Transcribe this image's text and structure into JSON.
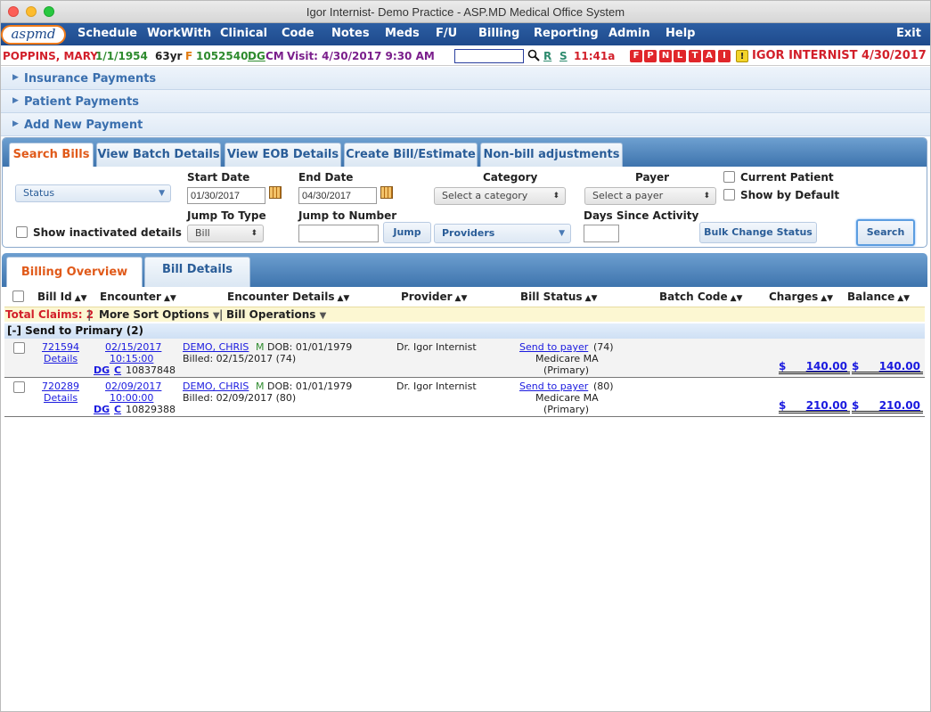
{
  "window": {
    "title": "Igor Internist- Demo Practice - ASP.MD Medical Office System"
  },
  "menubar": {
    "logo": "aspmd",
    "items": [
      "Schedule",
      "WorkWith",
      "Clinical",
      "Code",
      "Notes",
      "Meds",
      "F/U",
      "Billing",
      "Reporting",
      "Admin",
      "Help"
    ],
    "exit": "Exit"
  },
  "patient": {
    "name": "POPPINS, MARY",
    "dob": "1/1/1954",
    "age": "63yr",
    "sex": "F",
    "id": "1052540",
    "dg": "DG",
    "cm": "CM",
    "visit": "Visit: 4/30/2017 9:30 AM",
    "search_value": "",
    "r": "R",
    "s": "S",
    "time": "11:41a",
    "flags": [
      "F",
      "P",
      "N",
      "L",
      "T",
      "A",
      "I"
    ],
    "warning": "!",
    "doctor_date": "IGOR INTERNIST 4/30/2017"
  },
  "accordion": [
    "Insurance Payments",
    "Patient Payments",
    "Add New Payment"
  ],
  "search_panel": {
    "tabs": [
      "Search Bills",
      "View Batch Details",
      "View EOB Details",
      "Create Bill/Estimate",
      "Non-bill adjustments"
    ],
    "status_dropdown": "Status",
    "start_date_label": "Start Date",
    "start_date": "01/30/2017",
    "end_date_label": "End Date",
    "end_date": "04/30/2017",
    "category_label": "Category",
    "category_placeholder": "Select a category",
    "payer_label": "Payer",
    "payer_placeholder": "Select a payer",
    "current_patient": "Current Patient",
    "show_by_default": "Show by Default",
    "show_inactivated": "Show inactivated details",
    "jump_type_label": "Jump To Type",
    "jump_type": "Bill",
    "jump_number_label": "Jump to Number",
    "jump_number": "",
    "jump_button": "Jump",
    "providers_dropdown": "Providers",
    "days_label": "Days Since Activity",
    "days_value": "",
    "bulk_button": "Bulk Change Status",
    "search_button": "Search"
  },
  "results": {
    "tabs": [
      "Billing Overview",
      "Bill Details"
    ],
    "columns": [
      "Bill Id",
      "Encounter",
      "Encounter Details",
      "Provider",
      "Bill Status",
      "Batch Code",
      "Charges",
      "Balance"
    ],
    "total_claims_label": "Total Claims: 2",
    "more_sort": "More Sort Options",
    "bill_operations": "Bill Operations",
    "group_label": "[-] Send to Primary (2)",
    "rows": [
      {
        "bill_id": "721594",
        "details": "Details",
        "enc_date": "02/15/2017",
        "enc_time": "10:15:00",
        "dg": "DG",
        "c": "C",
        "enc_number": "10837848",
        "patient": "DEMO, CHRIS",
        "sex": "M",
        "dob": "DOB: 01/01/1979",
        "billed": "Billed: 02/15/2017 (74)",
        "provider": "Dr. Igor Internist",
        "status_link": "Send to payer",
        "status_count": "(74)",
        "payer": "Medicare MA",
        "payer_type": "(Primary)",
        "batch_code": "",
        "charges": "140.00",
        "balance": "140.00"
      },
      {
        "bill_id": "720289",
        "details": "Details",
        "enc_date": "02/09/2017",
        "enc_time": "10:00:00",
        "dg": "DG",
        "c": "C",
        "enc_number": "10829388",
        "patient": "DEMO, CHRIS",
        "sex": "M",
        "dob": "DOB: 01/01/1979",
        "billed": "Billed: 02/09/2017 (80)",
        "provider": "Dr. Igor Internist",
        "status_link": "Send to payer",
        "status_count": "(80)",
        "payer": "Medicare MA",
        "payer_type": "(Primary)",
        "batch_code": "",
        "charges": "210.00",
        "balance": "210.00"
      }
    ],
    "currency": "$"
  }
}
